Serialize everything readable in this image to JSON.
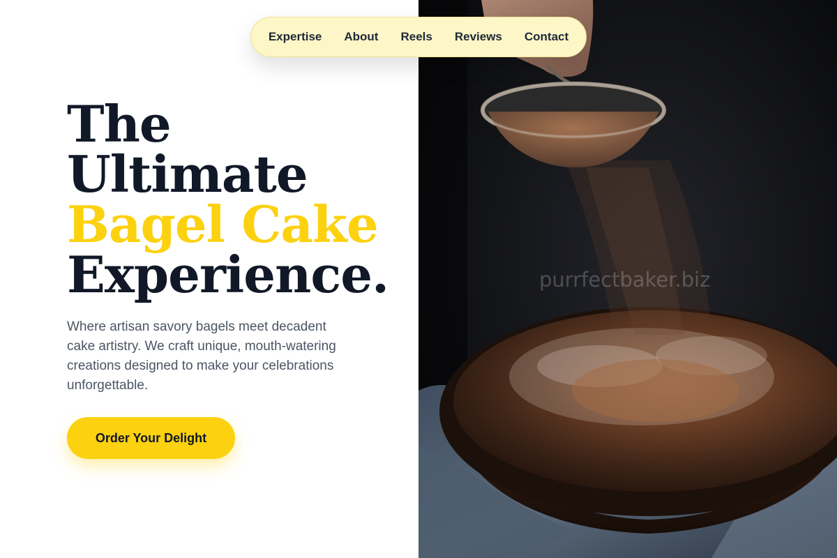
{
  "nav": {
    "links": [
      "Expertise",
      "About",
      "Reels",
      "Reviews",
      "Contact"
    ]
  },
  "hero": {
    "title_lines": [
      "The",
      "Ultimate",
      "Bagel Cake",
      "Experience."
    ],
    "description": "Where artisan savory bagels meet decadent cake artistry. We craft unique, mouth-watering creations designed to make your celebrations unforgettable.",
    "cta_label": "Order Your Delight"
  },
  "image": {
    "subject": "Cocoa powder sifted over a round dark cake",
    "watermark": "purrfectbaker.biz"
  },
  "colors": {
    "accent": "#fcd10f",
    "nav_bg": "#fdf6c6",
    "heading": "#111827",
    "body_text": "#4b5563"
  }
}
